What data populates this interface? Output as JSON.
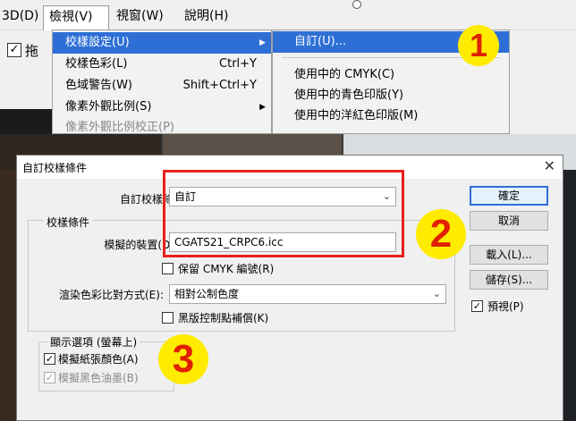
{
  "menubar": {
    "item0": "3D(D)",
    "item1": "檢視(V)",
    "item2": "視窗(W)",
    "item3": "說明(H)"
  },
  "below_menu_fragment": "拖",
  "view_menu": {
    "items": [
      {
        "label": "校樣設定(U)",
        "shortcut": "",
        "submenu": "▶"
      },
      {
        "label": "校樣色彩(L)",
        "shortcut": "Ctrl+Y",
        "submenu": ""
      },
      {
        "label": "色域警告(W)",
        "shortcut": "Shift+Ctrl+Y",
        "submenu": ""
      },
      {
        "label": "像素外觀比例(S)",
        "shortcut": "",
        "submenu": "▶"
      },
      {
        "label": "像素外觀比例校正(P)",
        "shortcut": "",
        "submenu": ""
      }
    ]
  },
  "proof_submenu": {
    "items": [
      "自訂(U)...",
      "使用中的 CMYK(C)",
      "使用中的青色印版(Y)",
      "使用中的洋紅色印版(M)"
    ]
  },
  "badges": {
    "one": "1",
    "two": "2",
    "three": "3"
  },
  "dialog": {
    "title": "自訂校樣條件",
    "close": "✕",
    "custom_label": "自訂校樣條件(I):",
    "custom_value": "自訂",
    "proof_group": "校樣條件",
    "device_label": "模擬的裝置(D):",
    "device_value": "CGATS21_CRPC6.icc",
    "preserve_cmyk": "保留 CMYK 編號(R)",
    "intent_label": "渲染色彩比對方式(E):",
    "intent_value": "相對公制色度",
    "black_point": "黑版控制點補償(K)",
    "display_group": "顯示選項 (螢幕上)",
    "simulate_paper": "模擬紙張顏色(A)",
    "simulate_ink": "模擬黑色油墨(B)",
    "ok": "確定",
    "cancel": "取消",
    "load": "載入(L)...",
    "save": "儲存(S)...",
    "preview": "預視(P)",
    "check_mark": "✓",
    "dropdown_glyph": "⌄"
  },
  "colors": {
    "highlight": "#2e6fd6",
    "annotation_red": "#e8201c",
    "badge_yellow": "#ffeb00"
  }
}
